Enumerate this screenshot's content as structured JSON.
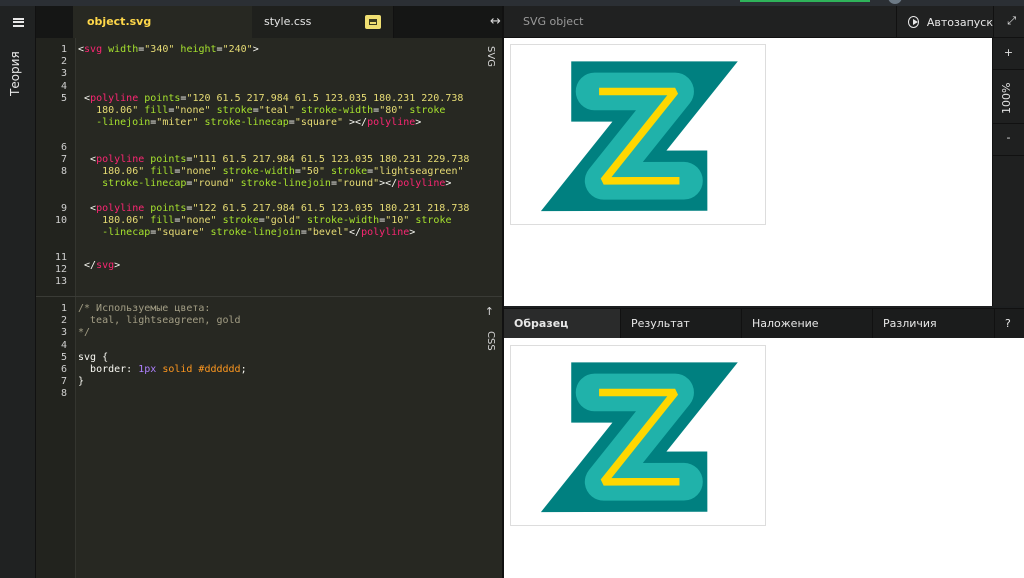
{
  "sidebar": {
    "theory_label": "Теория"
  },
  "tabs": {
    "svg_file": "object.svg",
    "css_file": "style.css"
  },
  "editor_svg": {
    "mode_label": "SVG",
    "line_numbers": [
      "1",
      "2",
      "3",
      "4",
      "5",
      "",
      "",
      "6",
      "7",
      "8",
      "",
      "",
      "9",
      "10",
      "",
      "",
      "11",
      "12",
      "13"
    ]
  },
  "editor_css": {
    "mode_label": "CSS",
    "line_numbers": [
      "1",
      "2",
      "3",
      "4",
      "5",
      "6",
      "7",
      "8"
    ],
    "comment": [
      "/* Используемые цвета:",
      "  teal, lightseagreen, gold",
      "*/"
    ],
    "selector": "svg {",
    "property": "border",
    "value_num": "1px",
    "value_rest": "solid #dddddd",
    "close": "}"
  },
  "svg_code": {
    "open_w": "340",
    "open_h": "240",
    "p1_points_a": "120 61.5 217.984 61.5 123.035 180.231 220.738",
    "p1_points_b": "180.06",
    "p1_fill": "none",
    "p1_stroke": "teal",
    "p1_sw": "80",
    "p1_join": "miter",
    "p1_cap": "square",
    "p2_points_a": "111 61.5 217.984 61.5 123.035 180.231 229.738",
    "p2_points_b": "180.06",
    "p2_fill": "none",
    "p2_sw": "50",
    "p2_stroke": "lightseagreen",
    "p2_cap": "round",
    "p2_join": "round",
    "p3_points_a": "122 61.5 217.984 61.5 123.035 180.231 218.738",
    "p3_points_b": "180.06",
    "p3_fill": "none",
    "p3_stroke": "gold",
    "p3_sw": "10",
    "p3_cap": "square",
    "p3_join": "bevel"
  },
  "preview": {
    "title": "SVG object",
    "autorun": "Автозапуск",
    "zoom_plus": "+",
    "zoom_value": "100%",
    "zoom_minus": "-"
  },
  "compare_tabs": [
    "Образец",
    "Результат",
    "Наложение",
    "Различия",
    "?"
  ],
  "colors": {
    "teal": "#008080",
    "lightseagreen": "#20b2aa",
    "gold": "#ffd700",
    "border": "#dddddd"
  }
}
